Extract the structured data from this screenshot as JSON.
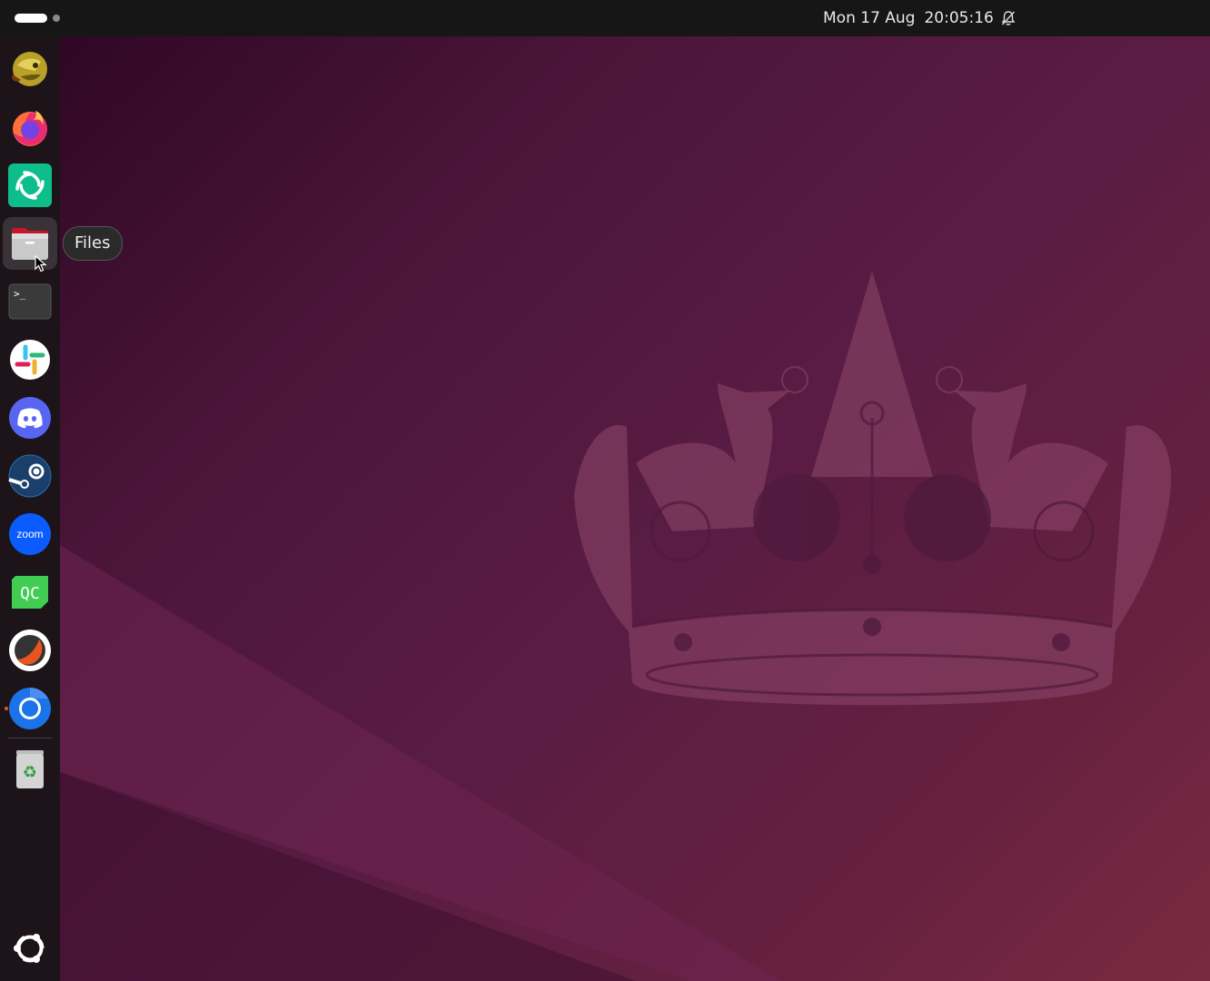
{
  "topbar": {
    "clock_date": "Mon 17 Aug",
    "clock_time": "20:05:16",
    "notification_icon": "bell-muted-icon"
  },
  "dock": {
    "items": [
      {
        "name": "app-globe",
        "icon": "globe-app-icon"
      },
      {
        "name": "firefox",
        "icon": "firefox-icon"
      },
      {
        "name": "element",
        "icon": "element-icon"
      },
      {
        "name": "files",
        "icon": "files-icon",
        "hovered": true
      },
      {
        "name": "terminal",
        "icon": "terminal-icon",
        "glyph": ">_"
      },
      {
        "name": "slack",
        "icon": "slack-icon"
      },
      {
        "name": "discord",
        "icon": "discord-icon"
      },
      {
        "name": "steam",
        "icon": "steam-icon"
      },
      {
        "name": "zoom",
        "icon": "zoom-icon",
        "glyph": "zoom"
      },
      {
        "name": "qt-creator",
        "icon": "qt-creator-icon",
        "glyph": "QC"
      },
      {
        "name": "app-orange",
        "icon": "orange-circle-app-icon"
      },
      {
        "name": "chromium",
        "icon": "chromium-icon",
        "running": true
      },
      {
        "name": "trash",
        "icon": "trash-icon"
      }
    ],
    "show_apps_icon": "ubuntu-logo-icon"
  },
  "tooltip": {
    "label": "Files"
  },
  "colors": {
    "topbar": "#161616",
    "dock": "#1c1419",
    "accent": "#e95420",
    "wallpaper": "#5a1c44"
  }
}
